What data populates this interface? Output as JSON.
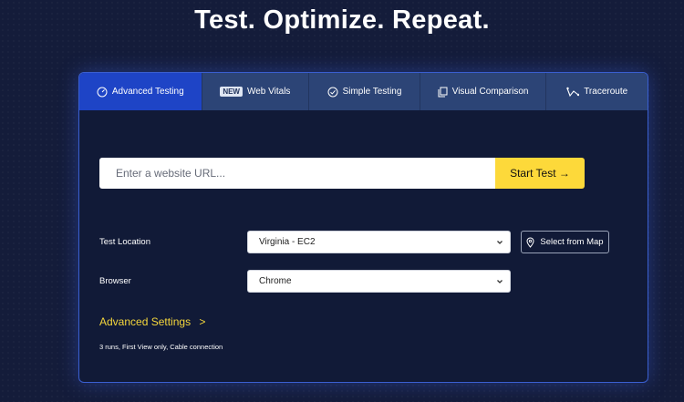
{
  "hero": {
    "title": "Test. Optimize. Repeat."
  },
  "tabs": [
    {
      "label": "Advanced Testing",
      "icon": "gauge-icon",
      "active": true
    },
    {
      "label": "Web Vitals",
      "badge": "NEW",
      "active": false
    },
    {
      "label": "Simple Testing",
      "icon": "check-circle-icon",
      "active": false
    },
    {
      "label": "Visual Comparison",
      "icon": "copy-icon",
      "active": false
    },
    {
      "label": "Traceroute",
      "icon": "route-icon",
      "active": false
    }
  ],
  "url_form": {
    "placeholder": "Enter a website URL...",
    "value": "",
    "start_label": "Start Test →"
  },
  "location": {
    "label": "Test Location",
    "value": "Virginia - EC2",
    "map_button_label": "Select from Map"
  },
  "browser": {
    "label": "Browser",
    "value": "Chrome"
  },
  "advanced": {
    "label": "Advanced Settings",
    "arrow": ">"
  },
  "summary": "3 runs, First View only, Cable connection",
  "colors": {
    "background": "#141c3a",
    "panel": "#111a37",
    "tab_bar": "#2c4476",
    "tab_active": "#1e44c6",
    "accent_yellow": "#fdd93a",
    "link_yellow": "#f5d73c"
  }
}
